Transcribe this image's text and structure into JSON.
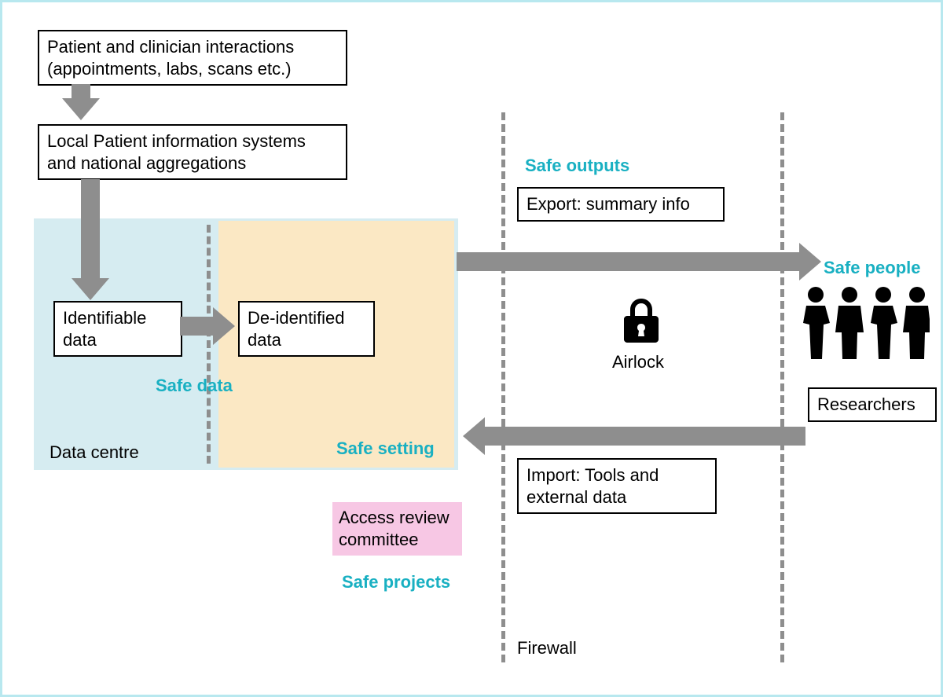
{
  "boxes": {
    "patient_interactions": "Patient and clinician interactions (appointments, labs, scans etc.)",
    "local_systems": "Local Patient information systems and national aggregations",
    "identifiable": "Identifiable data",
    "deidentified": "De-identified data",
    "export": "Export: summary info",
    "import": "Import: Tools and external data",
    "researchers": "Researchers",
    "access_review": "Access review committee"
  },
  "labels": {
    "data_centre": "Data centre",
    "safe_data": "Safe data",
    "safe_setting": "Safe setting",
    "safe_outputs": "Safe outputs",
    "safe_people": "Safe people",
    "safe_projects": "Safe projects",
    "airlock": "Airlock",
    "firewall": "Firewall"
  }
}
